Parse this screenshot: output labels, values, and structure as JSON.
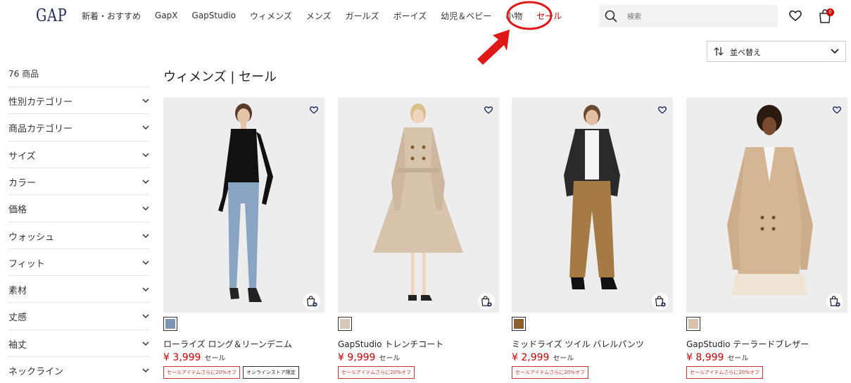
{
  "header": {
    "logo": "GAP",
    "nav": [
      {
        "label": "新着・おすすめ"
      },
      {
        "label": "GapX"
      },
      {
        "label": "GapStudio"
      },
      {
        "label": "ウィメンズ"
      },
      {
        "label": "メンズ"
      },
      {
        "label": "ガールズ"
      },
      {
        "label": "ボーイズ"
      },
      {
        "label": "幼児＆ベビー"
      },
      {
        "label": "小物"
      },
      {
        "label": "セール"
      }
    ],
    "search_placeholder": "検索",
    "cart_count": "0"
  },
  "sort": {
    "label": "並べ替え"
  },
  "sidebar": {
    "count": "76 商品",
    "filters": [
      {
        "label": "性別カテゴリー"
      },
      {
        "label": "商品カテゴリー"
      },
      {
        "label": "サイズ"
      },
      {
        "label": "カラー"
      },
      {
        "label": "価格"
      },
      {
        "label": "ウォッシュ"
      },
      {
        "label": "フィット"
      },
      {
        "label": "素材"
      },
      {
        "label": "丈感"
      },
      {
        "label": "袖丈"
      },
      {
        "label": "ネックライン"
      }
    ]
  },
  "main": {
    "title": "ウィメンズ | セール",
    "products": [
      {
        "name": "ローライズ ロング＆リーンデニム",
        "price": "¥ 3,999",
        "sale": "セール",
        "swatch": "#7c95b0",
        "badges": [
          "セールアイテムさらに20%オフ",
          "オンラインストア限定"
        ]
      },
      {
        "name": "GapStudio トレンチコート",
        "price": "¥ 9,999",
        "sale": "セール",
        "swatch": "#d8c8b6",
        "badges": [
          "セールアイテムさらに20%オフ"
        ]
      },
      {
        "name": "ミッドライズ ツイル バレルパンツ",
        "price": "¥ 2,999",
        "sale": "セール",
        "swatch": "#8e5f2e",
        "badges": [
          "セールアイテムさらに20%オフ"
        ]
      },
      {
        "name": "GapStudio テーラードブレザー",
        "price": "¥ 8,999",
        "sale": "セール",
        "swatch": "#d9c2ab",
        "badges": [
          "セールアイテムさらに20%オフ"
        ]
      }
    ]
  },
  "colors": {
    "accent_red": "#cc0000",
    "annotation_red": "#e01818",
    "navy": "#1b2a5b"
  }
}
